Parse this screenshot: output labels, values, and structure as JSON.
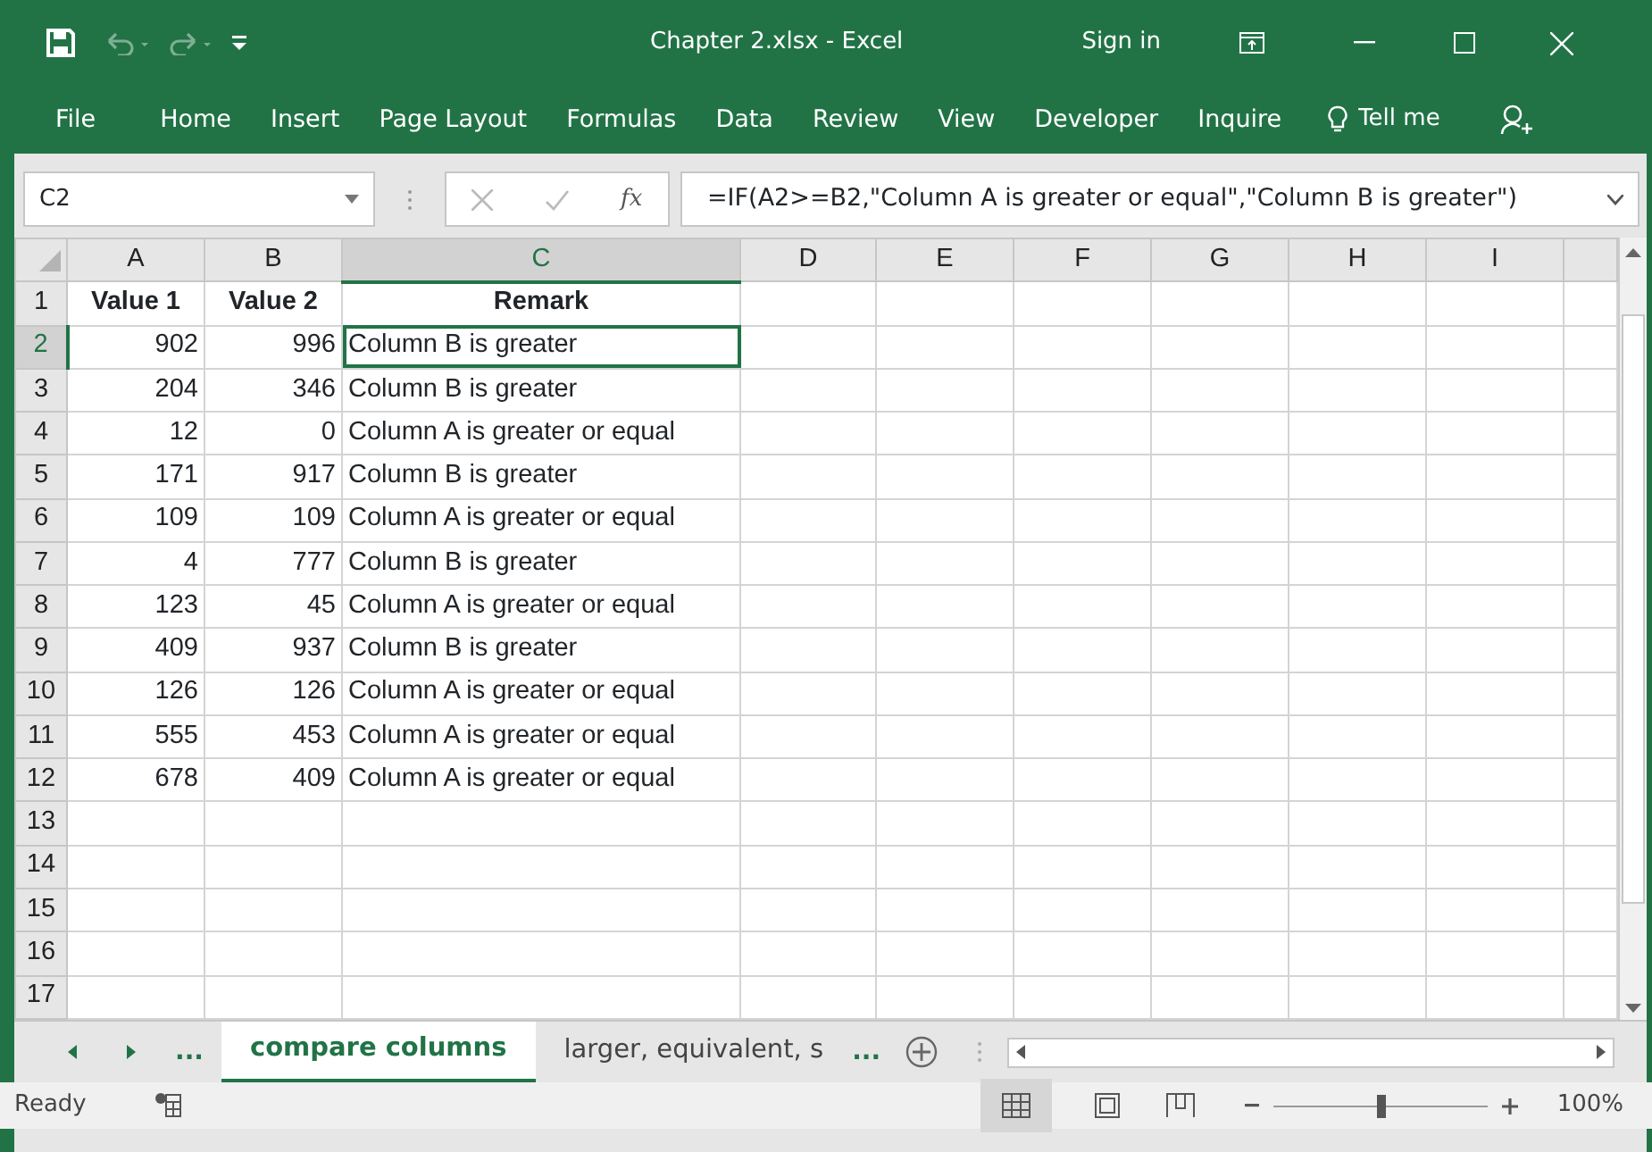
{
  "window": {
    "title": "Chapter 2.xlsx  -  Excel",
    "sign_in": "Sign in"
  },
  "ribbon_tabs": [
    {
      "label": "File"
    },
    {
      "label": "Home"
    },
    {
      "label": "Insert"
    },
    {
      "label": "Page Layout"
    },
    {
      "label": "Formulas"
    },
    {
      "label": "Data"
    },
    {
      "label": "Review"
    },
    {
      "label": "View"
    },
    {
      "label": "Developer"
    },
    {
      "label": "Inquire"
    }
  ],
  "tell_me": "Tell me",
  "formula_bar": {
    "name_box": "C2",
    "fx": "fx",
    "formula": "=IF(A2>=B2,\"Column A is greater or equal\",\"Column B is greater\")"
  },
  "columns": [
    {
      "label": "A",
      "selected": false
    },
    {
      "label": "B",
      "selected": false
    },
    {
      "label": "C",
      "selected": true
    },
    {
      "label": "D",
      "selected": false
    },
    {
      "label": "E",
      "selected": false
    },
    {
      "label": "F",
      "selected": false
    },
    {
      "label": "G",
      "selected": false
    },
    {
      "label": "H",
      "selected": false
    },
    {
      "label": "I",
      "selected": false
    }
  ],
  "rows": [
    {
      "header": "1",
      "kind": "header",
      "selected": false,
      "cells": [
        "Value 1",
        "Value 2",
        "Remark"
      ]
    },
    {
      "header": "2",
      "kind": "data",
      "selected": true,
      "cells": [
        "902",
        "996",
        "Column B is greater"
      ]
    },
    {
      "header": "3",
      "kind": "data",
      "selected": false,
      "cells": [
        "204",
        "346",
        "Column B is greater"
      ]
    },
    {
      "header": "4",
      "kind": "data",
      "selected": false,
      "cells": [
        "12",
        "0",
        "Column A is greater or equal"
      ]
    },
    {
      "header": "5",
      "kind": "data",
      "selected": false,
      "cells": [
        "171",
        "917",
        "Column B is greater"
      ]
    },
    {
      "header": "6",
      "kind": "data",
      "selected": false,
      "cells": [
        "109",
        "109",
        "Column A is greater or equal"
      ]
    },
    {
      "header": "7",
      "kind": "data",
      "selected": false,
      "cells": [
        "4",
        "777",
        "Column B is greater"
      ]
    },
    {
      "header": "8",
      "kind": "data",
      "selected": false,
      "cells": [
        "123",
        "45",
        "Column A is greater or equal"
      ]
    },
    {
      "header": "9",
      "kind": "data",
      "selected": false,
      "cells": [
        "409",
        "937",
        "Column B is greater"
      ]
    },
    {
      "header": "10",
      "kind": "data",
      "selected": false,
      "cells": [
        "126",
        "126",
        "Column A is greater or equal"
      ]
    },
    {
      "header": "11",
      "kind": "data",
      "selected": false,
      "cells": [
        "555",
        "453",
        "Column A is greater or equal"
      ]
    },
    {
      "header": "12",
      "kind": "data",
      "selected": false,
      "cells": [
        "678",
        "409",
        "Column A is greater or equal"
      ]
    },
    {
      "header": "13",
      "selected": false
    },
    {
      "header": "14",
      "selected": false
    },
    {
      "header": "15",
      "selected": false
    },
    {
      "header": "16",
      "selected": false
    },
    {
      "header": "17",
      "selected": false
    }
  ],
  "sheet_nav": {
    "more_left": "...",
    "more_right": "..."
  },
  "sheet_tabs": [
    {
      "label": "compare columns",
      "selected": true
    },
    {
      "label": "larger, equivalent, s",
      "selected": false
    }
  ],
  "status_bar": {
    "status": "Ready",
    "zoom": "100%",
    "level": 0.5
  }
}
